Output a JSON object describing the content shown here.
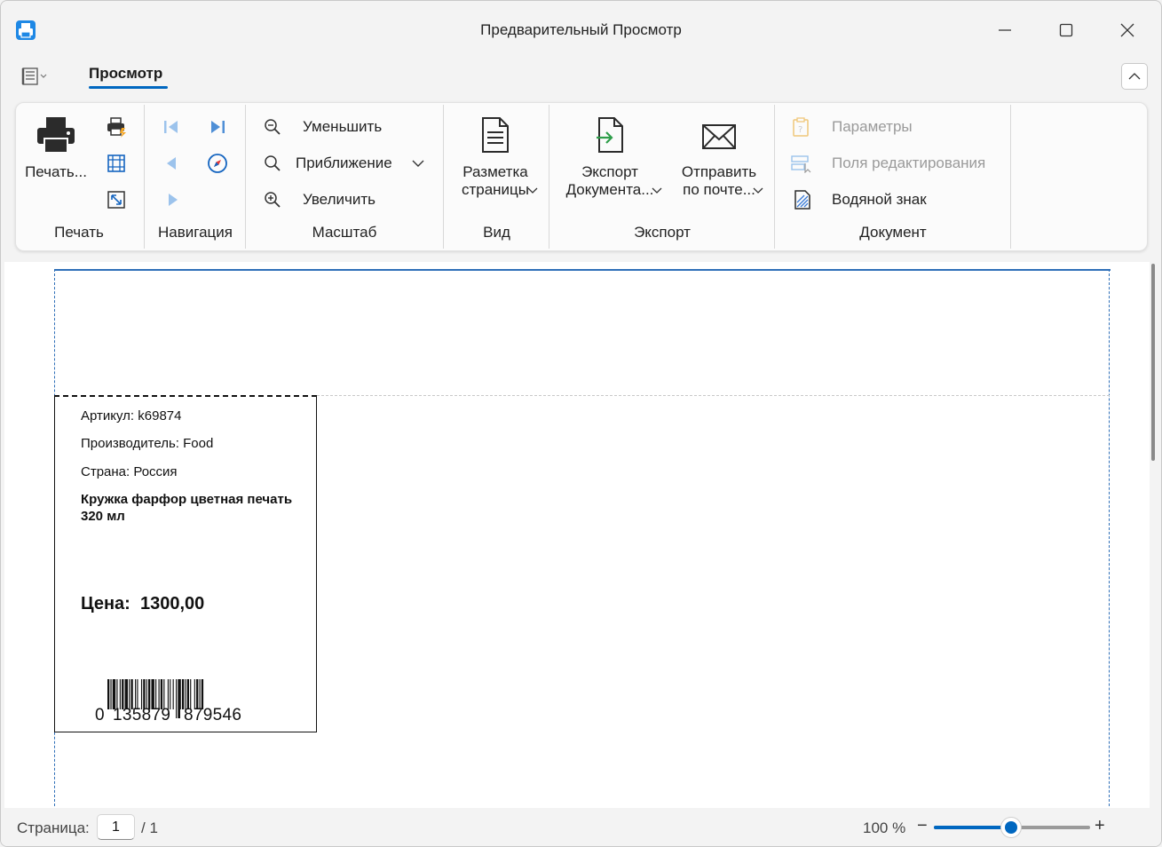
{
  "window": {
    "title": "Предварительный Просмотр"
  },
  "ribbon": {
    "tab": "Просмотр",
    "groups": {
      "print": {
        "label": "Печать",
        "print_button": "Печать..."
      },
      "navigation": {
        "label": "Навигация"
      },
      "zoom": {
        "label": "Масштаб",
        "zoom_out": "Уменьшить",
        "zoom": "Приближение",
        "zoom_in": "Увеличить"
      },
      "view": {
        "label": "Вид",
        "page_layout_line1": "Разметка",
        "page_layout_line2": "страницы"
      },
      "export": {
        "label": "Экспорт",
        "export_line1": "Экспорт",
        "export_line2": "Документа...",
        "send_line1": "Отправить",
        "send_line2": "по почте..."
      },
      "document": {
        "label": "Документ",
        "parameters": "Параметры",
        "edit_fields": "Поля редактирования",
        "watermark": "Водяной знак"
      }
    }
  },
  "label_card": {
    "article": "Артикул: k69874",
    "manufacturer": "Производитель: Food",
    "country": "Страна: Россия",
    "product_name": "Кружка фарфор цветная печать 320 мл",
    "price_label": "Цена:",
    "price_value": "1300,00",
    "barcode_first": "0",
    "barcode_left": "135879",
    "barcode_right": "879546"
  },
  "statusbar": {
    "page_label": "Страница:",
    "page_value": "1",
    "page_total": "/ 1",
    "zoom_text": "100 %",
    "zoom_level": 0.5
  },
  "colors": {
    "accent": "#0067c0",
    "page_border": "#2f6fb8"
  }
}
